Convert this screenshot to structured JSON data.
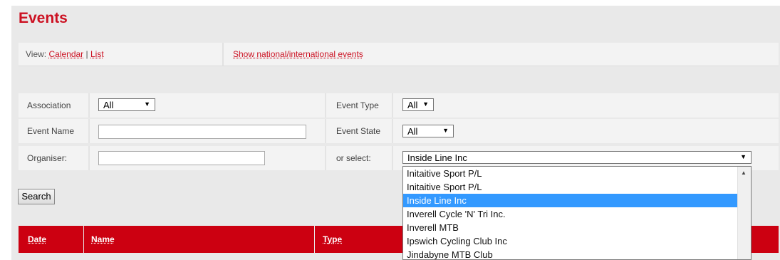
{
  "page": {
    "title": "Events"
  },
  "view": {
    "prefix": "View:",
    "calendar": "Calendar",
    "sep": "|",
    "list": "List",
    "show_national": "Show national/international events"
  },
  "filters": {
    "association_label": "Association",
    "association_value": "All",
    "event_type_label": "Event Type",
    "event_type_value": "All",
    "event_name_label": "Event Name",
    "event_name_value": "",
    "event_state_label": "Event State",
    "event_state_value": "All",
    "organiser_label": "Organiser:",
    "organiser_value": "",
    "or_select_label": "or select:",
    "or_select_value": "Inside Line Inc"
  },
  "search_button": "Search",
  "table": {
    "headers": [
      "Date",
      "Name",
      "Type"
    ]
  },
  "dropdown": {
    "options": [
      "Initaitive Sport P/L",
      "Initaitive Sport P/L",
      "Inside Line Inc",
      "Inverell Cycle 'N' Tri Inc.",
      "Inverell MTB",
      "Ipswich Cycling Club Inc",
      "Jindabyne MTB Club"
    ],
    "selected_index": 2
  },
  "colors": {
    "brand_red": "#cc1122",
    "header_red": "#cc0011",
    "selection_blue": "#3399ff"
  }
}
